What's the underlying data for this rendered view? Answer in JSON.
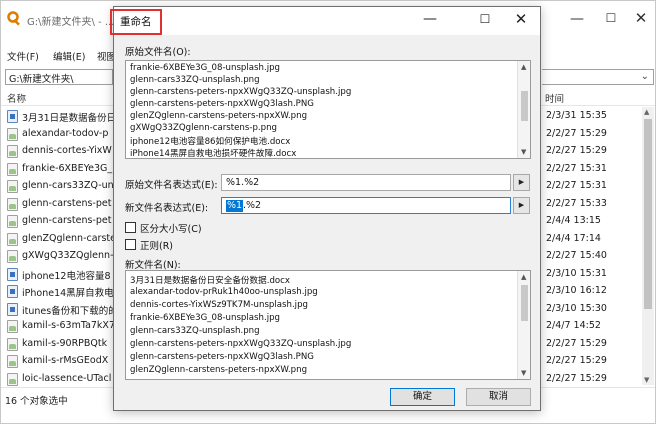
{
  "background": {
    "title": "G:\\新建文件夹\\ - ...",
    "menu": [
      "文件(F)",
      "编辑(E)",
      "视图"
    ],
    "address": "G:\\新建文件夹\\",
    "columns": {
      "name": "名称",
      "time": "时间"
    },
    "files": [
      {
        "name": "3月31日是数据备份日",
        "time": "2/3/31 15:35",
        "type": "doc"
      },
      {
        "name": "alexandar-todov-p",
        "time": "2/2/27 15:29",
        "type": "img"
      },
      {
        "name": "dennis-cortes-YixW",
        "time": "2/2/27 15:29",
        "type": "img"
      },
      {
        "name": "frankie-6XBEYe3G_",
        "time": "2/2/27 15:31",
        "type": "img"
      },
      {
        "name": "glenn-cars33ZQ-un",
        "time": "2/2/27 15:31",
        "type": "img"
      },
      {
        "name": "glenn-carstens-pet",
        "time": "2/2/27 15:33",
        "type": "img"
      },
      {
        "name": "glenn-carstens-pet",
        "time": "2/4/4 13:15",
        "type": "img"
      },
      {
        "name": "glenZQglenn-carste",
        "time": "2/4/4 17:14",
        "type": "img"
      },
      {
        "name": "gXWgQ33ZQglenn-",
        "time": "2/2/27 15:40",
        "type": "img"
      },
      {
        "name": "iphone12电池容量8",
        "time": "2/3/10 15:31",
        "type": "doc"
      },
      {
        "name": "iPhone14黑屏自救电",
        "time": "2/3/10 16:12",
        "type": "doc"
      },
      {
        "name": "itunes备份和下载的的",
        "time": "2/3/10 15:30",
        "type": "doc"
      },
      {
        "name": "kamil-s-63mTa7kX7",
        "time": "2/4/7 14:52",
        "type": "img"
      },
      {
        "name": "kamil-s-90RPBQtk",
        "time": "2/2/27 15:29",
        "type": "img"
      },
      {
        "name": "kamil-s-rMsGEodX",
        "time": "2/2/27 15:29",
        "type": "img"
      },
      {
        "name": "loic-lassence-UTacl",
        "time": "2/2/27 15:29",
        "type": "img"
      }
    ],
    "status": "16 个对象选中"
  },
  "dialog": {
    "title": "重命名",
    "original_label": "原始文件名(O):",
    "original_files": [
      "frankie-6XBEYe3G_08-unsplash.jpg",
      "glenn-cars33ZQ-unsplash.png",
      "glenn-carstens-peters-npxXWgQ33ZQ-unsplash.jpg",
      "glenn-carstens-peters-npxXWgQ3lash.PNG",
      "glenZQglenn-carstens-peters-npxXW.png",
      "gXWgQ33ZQglenn-carstens-p.png",
      "iphone12电池容量86如何保护电池.docx",
      "iPhone14黑屏自救电池损坏硬件故障.docx"
    ],
    "original_expr_label": "原始文件名表达式(E):",
    "original_expr_value": "%1.%2",
    "new_expr_label": "新文件名表达式(E):",
    "new_expr_selected": "%1",
    "new_expr_rest": ".%2",
    "case_label": "区分大小写(C)",
    "regex_label": "正则(R)",
    "new_names_label": "新文件名(N):",
    "new_files": [
      "3月31日是数据备份日安全备份数据.docx",
      "alexandar-todov-prRuk1h40oo-unsplash.jpg",
      "dennis-cortes-YixWSz9TK7M-unsplash.jpg",
      "frankie-6XBEYe3G_08-unsplash.jpg",
      "glenn-cars33ZQ-unsplash.png",
      "glenn-carstens-peters-npxXWgQ33ZQ-unsplash.jpg",
      "glenn-carstens-peters-npxXWgQ3lash.PNG",
      "glenZQglenn-carstens-peters-npxXW.png"
    ],
    "ok_label": "确定",
    "cancel_label": "取消",
    "arrow_glyph": "▶"
  }
}
